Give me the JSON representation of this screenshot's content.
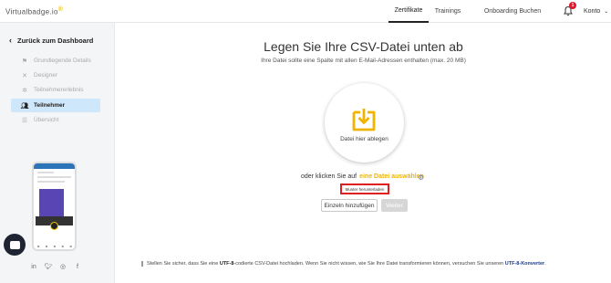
{
  "header": {
    "logo_text": "Virtualbadge.io",
    "logo_mark": "®",
    "nav": {
      "zertifikate": "Zertifikate",
      "trainings": "Trainings",
      "onboarding": "Onboarding Buchen"
    },
    "notification_count": "1",
    "account": "Konto"
  },
  "sidebar": {
    "back_label": "Zurück zum Dashboard",
    "items": [
      {
        "label": "Grundlegende Details",
        "icon": "flag-icon"
      },
      {
        "label": "Designer",
        "icon": "tools-icon"
      },
      {
        "label": "Teilnehmererlebnis",
        "icon": "sparkle-icon"
      },
      {
        "label": "Teilnehmer",
        "icon": "users-icon"
      },
      {
        "label": "Übersicht",
        "icon": "list-icon"
      }
    ],
    "active_index": 3
  },
  "main": {
    "title": "Legen Sie Ihre CSV-Datei unten ab",
    "subtitle": "Ihre Datei sollte eine Spalte mit allen E-Mail-Adressen enthalten (max. 20 MB)",
    "drop_label": "Datei hier ablegen",
    "choose_prefix": "oder klicken Sie auf",
    "choose_link": "eine Datei auswählen",
    "sample_download": "Muster herunterladen",
    "add_single": "Einzeln hinzufügen",
    "next": "Weiter",
    "hint_1": "Stellen Sie sicher, dass Sie eine",
    "hint_utf": "UTF-8",
    "hint_2": "-codierte CSV-Datei hochladen. Wenn Sie nicht wissen, wie Sie Ihre Datei transformieren können, versuchen Sie unseren",
    "hint_converter": "UTF-8-Konverter",
    "hint_end": "."
  },
  "colors": {
    "accent": "#f0b400",
    "active_bg": "#cfe7fb",
    "badge": "#e0162b",
    "highlight_border": "#e02020"
  }
}
